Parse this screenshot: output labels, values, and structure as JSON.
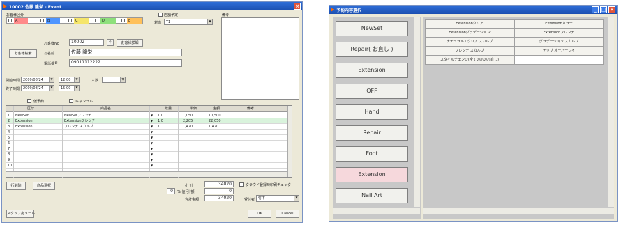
{
  "left": {
    "title": "10002 佐藤 隆栄 - Event",
    "area_label": "お客様区分",
    "colors": [
      "#ff8a8a",
      "#4f95ff",
      "#f5e56a",
      "#8ee07c",
      "#ffc05a"
    ],
    "color_letters": [
      "A",
      "B",
      "C",
      "D",
      "E"
    ],
    "checkbox_top": "店舗予定",
    "tantou_label": "対応",
    "tantou_value": "T1",
    "memo_label": "備考",
    "cust_no_label": "お客様No",
    "cust_no": "10002",
    "search_icon": "magnifier-icon",
    "detail_btn": "お客様詳細",
    "search_btn": "お客様検索",
    "name_label": "お名前",
    "name_value": "佐藤 隆栄",
    "tel_label": "電話番号",
    "tel_value": "09011112222",
    "start_label": "開始時間",
    "start_date": "2009/08/24",
    "start_time": "12:00",
    "end_label": "終了時間",
    "end_date": "2009/08/24",
    "end_time": "15:00",
    "people_label": "人数",
    "chk_temp": "仮予約",
    "chk_cancel": "キャンセル",
    "headers": [
      "区分",
      "商品名",
      "数量",
      "単価",
      "金額",
      "備考"
    ],
    "rows": [
      {
        "n": "1",
        "cat": "NewSet",
        "item": "NewSetフレンチ",
        "qty": "1 0",
        "price": "1,050",
        "amt": "10,500",
        "hl": false
      },
      {
        "n": "2",
        "cat": "Extension",
        "item": "Extensionフレンチ",
        "qty": "1 0",
        "price": "2,205",
        "amt": "22,050",
        "hl": true
      },
      {
        "n": "3",
        "cat": "Extension",
        "item": "フレンチ スカルプ",
        "qty": "1",
        "price": "1,470",
        "amt": "1,470",
        "hl": false
      },
      {
        "n": "4",
        "cat": "",
        "item": "",
        "qty": "",
        "price": "",
        "amt": "",
        "hl": false
      },
      {
        "n": "5",
        "cat": "",
        "item": "",
        "qty": "",
        "price": "",
        "amt": "",
        "hl": false
      },
      {
        "n": "6",
        "cat": "",
        "item": "",
        "qty": "",
        "price": "",
        "amt": "",
        "hl": false
      },
      {
        "n": "7",
        "cat": "",
        "item": "",
        "qty": "",
        "price": "",
        "amt": "",
        "hl": false
      },
      {
        "n": "8",
        "cat": "",
        "item": "",
        "qty": "",
        "price": "",
        "amt": "",
        "hl": false
      },
      {
        "n": "9",
        "cat": "",
        "item": "",
        "qty": "",
        "price": "",
        "amt": "",
        "hl": false
      },
      {
        "n": "10",
        "cat": "",
        "item": "",
        "qty": "",
        "price": "",
        "amt": "",
        "hl": false
      }
    ],
    "row_delete_btn": "行削除",
    "product_btn": "商品選択",
    "subtotal_label": "小 計",
    "subtotal": "34020",
    "discount_label": "% 値 引 額",
    "discount_pct": "0",
    "discount": "0",
    "total_label": "合計金額",
    "total": "34020",
    "chk_print": "クラウド登録時印刷チェック",
    "staff_label": "受付者",
    "staff_value": "竹下",
    "staff_mail_btn": "スタッフ宛メール",
    "ok_btn": "OK",
    "cancel_btn": "Cancel"
  },
  "right": {
    "title": "予約内容選択",
    "categories": [
      "NewSet",
      "Repair( お直し )",
      "Extension",
      "OFF",
      "Hand",
      "Repair",
      "Foot",
      "Extension",
      "Nail Art"
    ],
    "active_category": 7,
    "items": [
      "Extensionクリア",
      "Extensionカラー",
      "Extensionグラデーション",
      "Extensionフレンチ",
      "ナチュラル・クリア スカルプ",
      "グラデーション スカルプ",
      "フレンチ スカルプ",
      "チップ オーバーレイ",
      "スタイルチェンジ(全ての爪のお直し)",
      ""
    ]
  }
}
